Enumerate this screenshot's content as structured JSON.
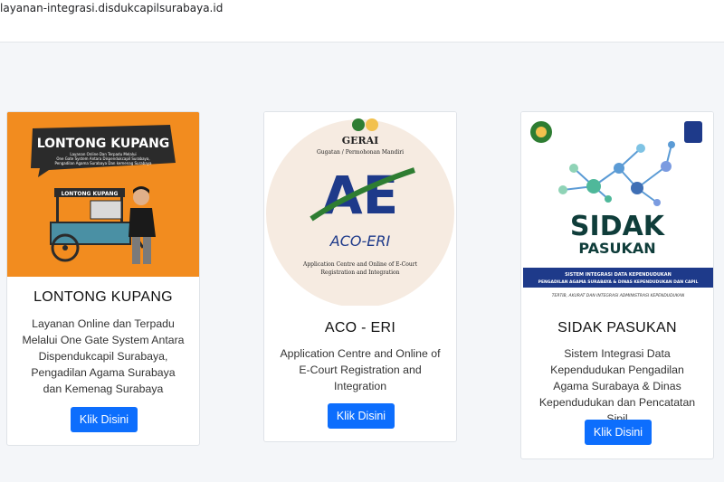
{
  "browser": {
    "url": "layanan-integrasi.disdukcapilsurabaya.id"
  },
  "cards": [
    {
      "logo": {
        "heading": "LONTONG KUPANG",
        "line1": "Layanan Online Dan Terpadu Melalui",
        "line2": "One Gate System Antara Dispendukcapil Surabaya,",
        "line3": "Pengadilan Agama Surabaya Dan kemenag Surabaya",
        "cart_sign": "LONTONG KUPANG"
      },
      "title": "LONTONG KUPANG",
      "description": "Layanan Online dan Terpadu Melalui One Gate System Antara Dispendukcapil Surabaya, Pengadilan Agama Surabaya dan Kemenag Surabaya",
      "button": "Klik Disini"
    },
    {
      "logo": {
        "top": "GERAI",
        "sub": "Gugatan / Permohonan Mandiri",
        "mark": "AE",
        "name": "ACO-ERI",
        "tag1": "Application Centre and Online of E-Court",
        "tag2": "Registration and Integration"
      },
      "title": "ACO - ERI",
      "description": "Application Centre and Online of E-Court Registration and Integration",
      "button": "Klik Disini"
    },
    {
      "logo": {
        "word1": "SIDAK",
        "word2": "PASUKAN",
        "banner1": "SISTEM INTEGRASI DATA KEPENDUDUKAN",
        "banner2": "PENGADILAN AGAMA SURABAYA & DINAS KEPENDUDUKAN DAN CAPIL",
        "tagline": "TERTIB, AKURAT DAN INTEGRASI ADMINISTRASI KEPENDUDUKAN"
      },
      "title": "SIDAK PASUKAN",
      "description": "Sistem Integrasi Data Kependudukan Pengadilan Agama Surabaya & Dinas Kependudukan dan Pencatatan Sipil",
      "button": "Klik Disini"
    }
  ]
}
